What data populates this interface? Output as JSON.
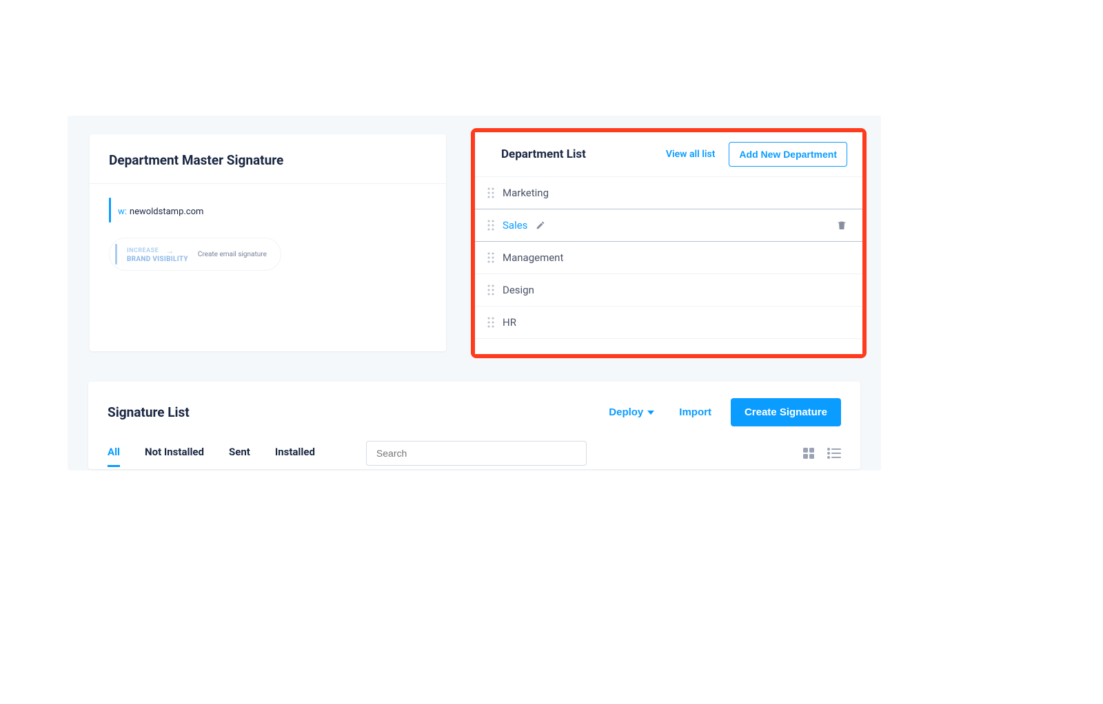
{
  "master": {
    "title": "Department Master Signature",
    "sig_prefix": "w:",
    "sig_domain": "newoldstamp.com",
    "promo_line1": "INCREASE",
    "promo_line2": "BRAND VISIBILITY",
    "promo_arrow": "→",
    "promo_btn": "Create email signature"
  },
  "department_list": {
    "title": "Department List",
    "view_all": "View all list",
    "add_new": "Add New Department",
    "items": [
      {
        "name": "Marketing",
        "selected": false
      },
      {
        "name": "Sales",
        "selected": true
      },
      {
        "name": "Management",
        "selected": false
      },
      {
        "name": "Design",
        "selected": false
      },
      {
        "name": "HR",
        "selected": false
      }
    ]
  },
  "signature_list": {
    "title": "Signature List",
    "deploy": "Deploy",
    "import": "Import",
    "create": "Create Signature",
    "tabs": {
      "all": "All",
      "not_installed": "Not Installed",
      "sent": "Sent",
      "installed": "Installed"
    },
    "search_placeholder": "Search"
  }
}
